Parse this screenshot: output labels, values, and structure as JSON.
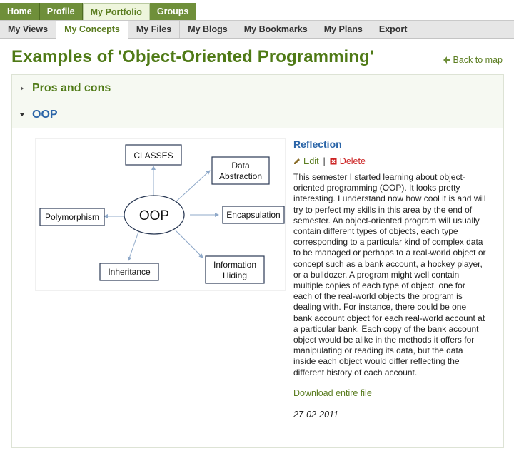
{
  "top_nav": [
    "Home",
    "Profile",
    "My Portfolio",
    "Groups"
  ],
  "sub_nav": [
    "My Views",
    "My Concepts",
    "My Files",
    "My Blogs",
    "My Bookmarks",
    "My Plans",
    "Export"
  ],
  "page": {
    "title": "Examples of 'Object-Oriented Programming'",
    "back_link": "Back to map"
  },
  "panels": [
    {
      "title": "Pros and cons",
      "expanded": false
    },
    {
      "title": "OOP",
      "expanded": true
    }
  ],
  "diagram": {
    "center": "OOP",
    "nodes": [
      {
        "text": [
          "CLASSES"
        ]
      },
      {
        "text": [
          "Data",
          "Abstraction"
        ]
      },
      {
        "text": [
          "Polymorphism"
        ]
      },
      {
        "text": [
          "Encapsulation"
        ]
      },
      {
        "text": [
          "Inheritance"
        ]
      },
      {
        "text": [
          "Information",
          "Hiding"
        ]
      }
    ]
  },
  "entry": {
    "title": "Reflection",
    "edit_label": "Edit",
    "delete_label": "Delete",
    "body": "This semester I started learning about object-oriented programming (OOP). It looks pretty interesting. I understand now how cool it is and will try to perfect my skills in this area by the end of semester. An object-oriented program will usually contain different types of objects, each type corresponding to a particular kind of complex data to be managed or perhaps to a real-world object or concept such as a bank account, a hockey player, or a bulldozer. A program might well contain multiple copies of each type of object, one for each of the real-world objects the program is dealing with. For instance, there could be one bank account object for each real-world account at a particular bank. Each copy of the bank account object would be alike in the methods it offers for manipulating or reading its data, but the data inside each object would differ reflecting the different history of each account.",
    "download_label": "Download entire file",
    "date": "27-02-2011"
  },
  "colors": {
    "nav_green": "#6f8f3a",
    "title_green": "#4f7a16",
    "link_blue": "#2b65a8",
    "delete_red": "#cc2222"
  }
}
